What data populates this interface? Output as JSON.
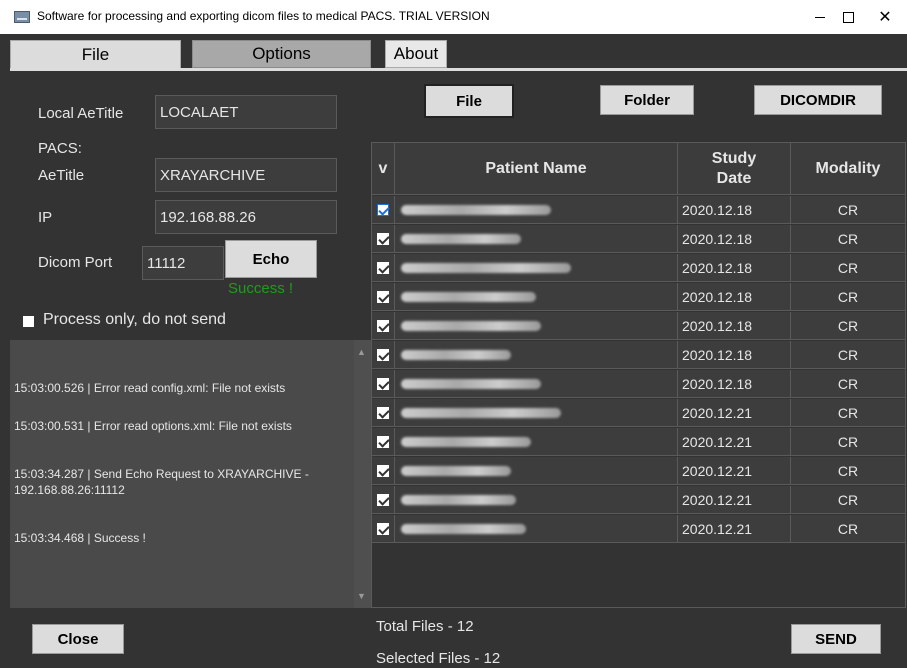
{
  "window": {
    "title": "Software for processing and exporting dicom files to medical PACS. TRIAL VERSION",
    "min_glyph": "—",
    "close_glyph": "✕"
  },
  "tabs": [
    {
      "label": "File"
    },
    {
      "label": "Options"
    },
    {
      "label": "About"
    }
  ],
  "settings": {
    "local_aetitle_label": "Local AeTitle",
    "local_aetitle_value": "LOCALAET",
    "pacs_label": "PACS:",
    "aetitle_label": "AeTitle",
    "aetitle_value": "XRAYARCHIVE",
    "ip_label": "IP",
    "ip_value": "192.168.88.26",
    "port_label": "Dicom Port",
    "port_value": "11112",
    "echo_label": "Echo",
    "echo_status": "Success !",
    "process_only_label": "Process only, do not send",
    "success_color": "#1f9b1f"
  },
  "log": [
    "15:03:00.526 | Error read config.xml: File not exists",
    "15:03:00.531 | Error read options.xml: File not exists",
    "15:03:34.287 | Send Echo Request to XRAYARCHIVE - 192.168.88.26:11112",
    "15:03:34.468 | Success !"
  ],
  "buttons": {
    "file": "File",
    "folder": "Folder",
    "dicomdir": "DICOMDIR",
    "close": "Close",
    "send": "SEND"
  },
  "grid": {
    "headers": {
      "check": "v",
      "patient": "Patient Name",
      "study_date": "Study Date",
      "modality": "Modality"
    },
    "rows": [
      {
        "date": "2020.12.18",
        "modality": "CR"
      },
      {
        "date": "2020.12.18",
        "modality": "CR"
      },
      {
        "date": "2020.12.18",
        "modality": "CR"
      },
      {
        "date": "2020.12.18",
        "modality": "CR"
      },
      {
        "date": "2020.12.18",
        "modality": "CR"
      },
      {
        "date": "2020.12.18",
        "modality": "CR"
      },
      {
        "date": "2020.12.18",
        "modality": "CR"
      },
      {
        "date": "2020.12.21",
        "modality": "CR"
      },
      {
        "date": "2020.12.21",
        "modality": "CR"
      },
      {
        "date": "2020.12.21",
        "modality": "CR"
      },
      {
        "date": "2020.12.21",
        "modality": "CR"
      },
      {
        "date": "2020.12.21",
        "modality": "CR"
      }
    ]
  },
  "footer": {
    "total_files": "Total Files - 12",
    "selected_files": "Selected Files - 12"
  }
}
